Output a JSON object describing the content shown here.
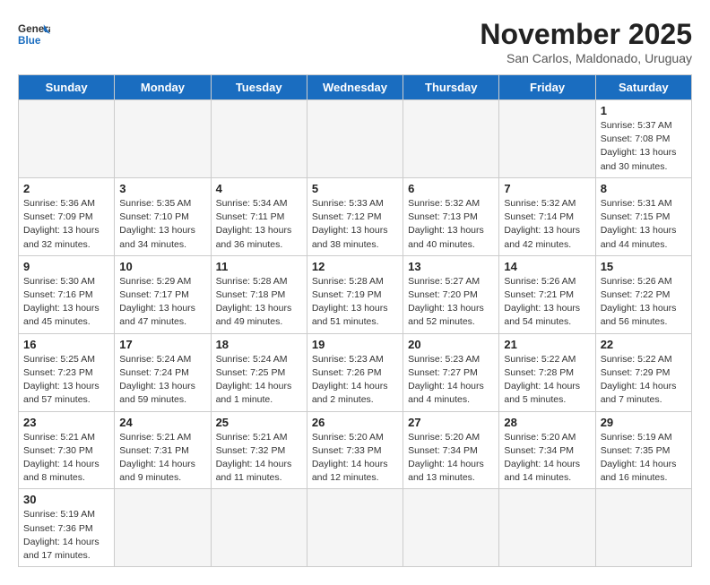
{
  "header": {
    "logo_general": "General",
    "logo_blue": "Blue",
    "month_title": "November 2025",
    "subtitle": "San Carlos, Maldonado, Uruguay"
  },
  "weekdays": [
    "Sunday",
    "Monday",
    "Tuesday",
    "Wednesday",
    "Thursday",
    "Friday",
    "Saturday"
  ],
  "weeks": [
    [
      {
        "day": "",
        "empty": true
      },
      {
        "day": "",
        "empty": true
      },
      {
        "day": "",
        "empty": true
      },
      {
        "day": "",
        "empty": true
      },
      {
        "day": "",
        "empty": true
      },
      {
        "day": "",
        "empty": true
      },
      {
        "day": "1",
        "sunrise": "5:37 AM",
        "sunset": "7:08 PM",
        "daylight": "13 hours and 30 minutes."
      }
    ],
    [
      {
        "day": "2",
        "sunrise": "5:36 AM",
        "sunset": "7:09 PM",
        "daylight": "13 hours and 32 minutes."
      },
      {
        "day": "3",
        "sunrise": "5:35 AM",
        "sunset": "7:10 PM",
        "daylight": "13 hours and 34 minutes."
      },
      {
        "day": "4",
        "sunrise": "5:34 AM",
        "sunset": "7:11 PM",
        "daylight": "13 hours and 36 minutes."
      },
      {
        "day": "5",
        "sunrise": "5:33 AM",
        "sunset": "7:12 PM",
        "daylight": "13 hours and 38 minutes."
      },
      {
        "day": "6",
        "sunrise": "5:32 AM",
        "sunset": "7:13 PM",
        "daylight": "13 hours and 40 minutes."
      },
      {
        "day": "7",
        "sunrise": "5:32 AM",
        "sunset": "7:14 PM",
        "daylight": "13 hours and 42 minutes."
      },
      {
        "day": "8",
        "sunrise": "5:31 AM",
        "sunset": "7:15 PM",
        "daylight": "13 hours and 44 minutes."
      }
    ],
    [
      {
        "day": "9",
        "sunrise": "5:30 AM",
        "sunset": "7:16 PM",
        "daylight": "13 hours and 45 minutes."
      },
      {
        "day": "10",
        "sunrise": "5:29 AM",
        "sunset": "7:17 PM",
        "daylight": "13 hours and 47 minutes."
      },
      {
        "day": "11",
        "sunrise": "5:28 AM",
        "sunset": "7:18 PM",
        "daylight": "13 hours and 49 minutes."
      },
      {
        "day": "12",
        "sunrise": "5:28 AM",
        "sunset": "7:19 PM",
        "daylight": "13 hours and 51 minutes."
      },
      {
        "day": "13",
        "sunrise": "5:27 AM",
        "sunset": "7:20 PM",
        "daylight": "13 hours and 52 minutes."
      },
      {
        "day": "14",
        "sunrise": "5:26 AM",
        "sunset": "7:21 PM",
        "daylight": "13 hours and 54 minutes."
      },
      {
        "day": "15",
        "sunrise": "5:26 AM",
        "sunset": "7:22 PM",
        "daylight": "13 hours and 56 minutes."
      }
    ],
    [
      {
        "day": "16",
        "sunrise": "5:25 AM",
        "sunset": "7:23 PM",
        "daylight": "13 hours and 57 minutes."
      },
      {
        "day": "17",
        "sunrise": "5:24 AM",
        "sunset": "7:24 PM",
        "daylight": "13 hours and 59 minutes."
      },
      {
        "day": "18",
        "sunrise": "5:24 AM",
        "sunset": "7:25 PM",
        "daylight": "14 hours and 1 minute."
      },
      {
        "day": "19",
        "sunrise": "5:23 AM",
        "sunset": "7:26 PM",
        "daylight": "14 hours and 2 minutes."
      },
      {
        "day": "20",
        "sunrise": "5:23 AM",
        "sunset": "7:27 PM",
        "daylight": "14 hours and 4 minutes."
      },
      {
        "day": "21",
        "sunrise": "5:22 AM",
        "sunset": "7:28 PM",
        "daylight": "14 hours and 5 minutes."
      },
      {
        "day": "22",
        "sunrise": "5:22 AM",
        "sunset": "7:29 PM",
        "daylight": "14 hours and 7 minutes."
      }
    ],
    [
      {
        "day": "23",
        "sunrise": "5:21 AM",
        "sunset": "7:30 PM",
        "daylight": "14 hours and 8 minutes."
      },
      {
        "day": "24",
        "sunrise": "5:21 AM",
        "sunset": "7:31 PM",
        "daylight": "14 hours and 9 minutes."
      },
      {
        "day": "25",
        "sunrise": "5:21 AM",
        "sunset": "7:32 PM",
        "daylight": "14 hours and 11 minutes."
      },
      {
        "day": "26",
        "sunrise": "5:20 AM",
        "sunset": "7:33 PM",
        "daylight": "14 hours and 12 minutes."
      },
      {
        "day": "27",
        "sunrise": "5:20 AM",
        "sunset": "7:34 PM",
        "daylight": "14 hours and 13 minutes."
      },
      {
        "day": "28",
        "sunrise": "5:20 AM",
        "sunset": "7:34 PM",
        "daylight": "14 hours and 14 minutes."
      },
      {
        "day": "29",
        "sunrise": "5:19 AM",
        "sunset": "7:35 PM",
        "daylight": "14 hours and 16 minutes."
      }
    ],
    [
      {
        "day": "30",
        "sunrise": "5:19 AM",
        "sunset": "7:36 PM",
        "daylight": "14 hours and 17 minutes."
      },
      {
        "day": "",
        "empty": true
      },
      {
        "day": "",
        "empty": true
      },
      {
        "day": "",
        "empty": true
      },
      {
        "day": "",
        "empty": true
      },
      {
        "day": "",
        "empty": true
      },
      {
        "day": "",
        "empty": true
      }
    ]
  ],
  "labels": {
    "sunrise": "Sunrise:",
    "sunset": "Sunset:",
    "daylight": "Daylight:"
  }
}
